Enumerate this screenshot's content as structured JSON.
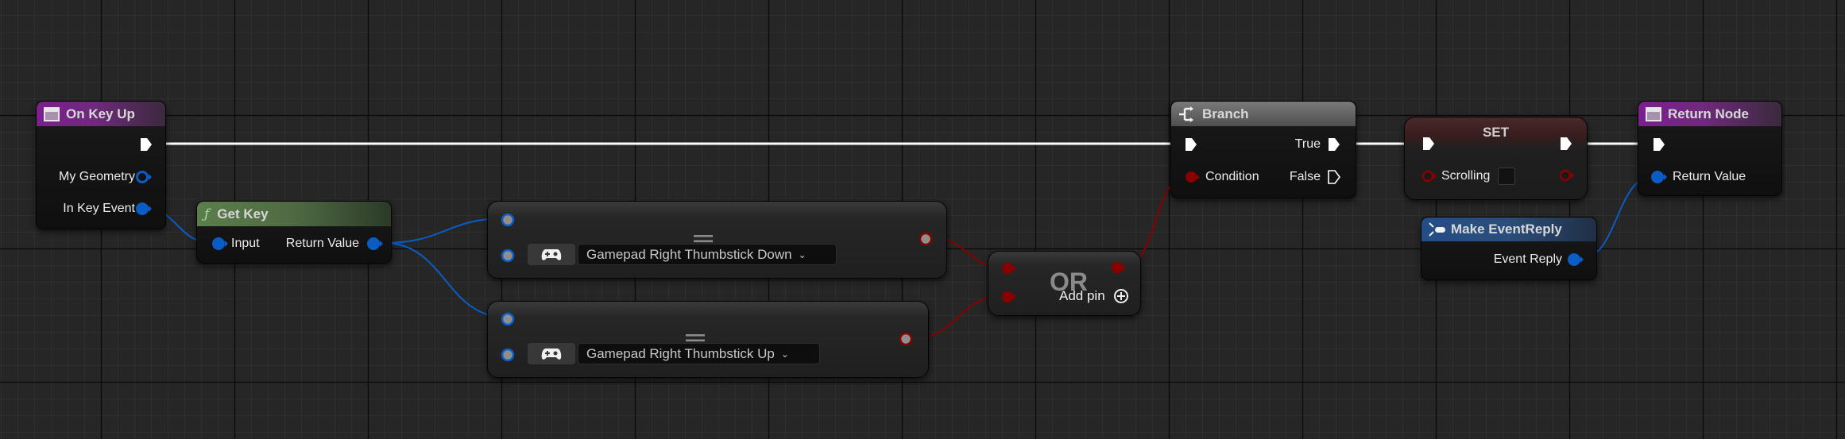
{
  "app": "Blueprint Graph Editor",
  "colors": {
    "background": "#262626",
    "grid_minor": "#2f2f2f",
    "grid_major": "#0c0c0c",
    "exec_wire": "#ffffff",
    "struct_wire": "#0b5cc5",
    "bool_wire": "#8a0000",
    "event_header": "#7c1f8f",
    "function_header": "#5b7e4b",
    "make_header": "#234d86"
  },
  "nodes": {
    "on_key_up": {
      "title": "On Key Up",
      "icon": "event-icon",
      "pins": {
        "my_geometry": "My Geometry",
        "in_key_event": "In Key Event"
      }
    },
    "get_key": {
      "title": "Get Key",
      "icon": "function-icon",
      "icon_glyph": "ƒ",
      "pins": {
        "input": "Input",
        "return_value": "Return Value"
      }
    },
    "equal_1": {
      "operator": "==",
      "key_icon": "gamepad-icon",
      "key_value": "Gamepad Right Thumbstick Down"
    },
    "equal_2": {
      "operator": "==",
      "key_icon": "gamepad-icon",
      "key_value": "Gamepad Right Thumbstick Up"
    },
    "or_node": {
      "operator": "OR",
      "add_pin_label": "Add pin",
      "add_pin_glyph": "+"
    },
    "branch": {
      "title": "Branch",
      "icon": "branch-icon",
      "pins": {
        "condition": "Condition",
        "true": "True",
        "false": "False"
      }
    },
    "set": {
      "title": "SET",
      "variable": "Scrolling",
      "value_checked": false
    },
    "make_event_reply": {
      "title": "Make EventReply",
      "icon": "make-struct-icon",
      "pins": {
        "event_reply": "Event Reply"
      }
    },
    "return_node": {
      "title": "Return Node",
      "icon": "event-icon",
      "pins": {
        "return_value": "Return Value"
      }
    }
  }
}
